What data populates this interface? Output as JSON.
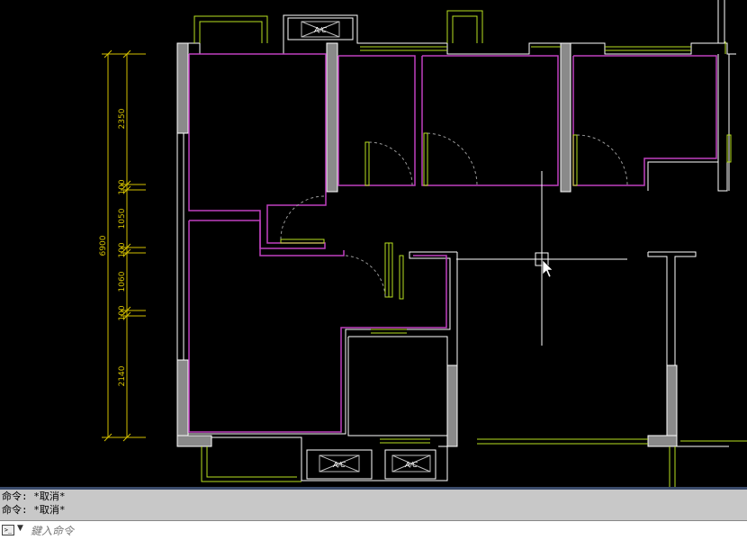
{
  "drawing": {
    "dimensions": {
      "overall": "6900",
      "segments": [
        "2350",
        "100",
        "1050",
        "100",
        "1060",
        "100",
        "2140"
      ]
    },
    "ac_label": "A/C",
    "colors": {
      "background": "#000000",
      "wall_fill": "#8a8a8a",
      "wall_line": "#ffffff",
      "room_outline": "#c040c0",
      "dimension": "#d4c000",
      "window": "#b8e020",
      "door_arc": "#9a9a9a",
      "crosshair": "#ffffff"
    }
  },
  "command_line": {
    "history": [
      "命令: *取消*",
      "命令: *取消*"
    ],
    "placeholder": "鍵入命令",
    "icon": "command-prompt-icon",
    "dropdown_icon": "chevron-down-icon"
  }
}
